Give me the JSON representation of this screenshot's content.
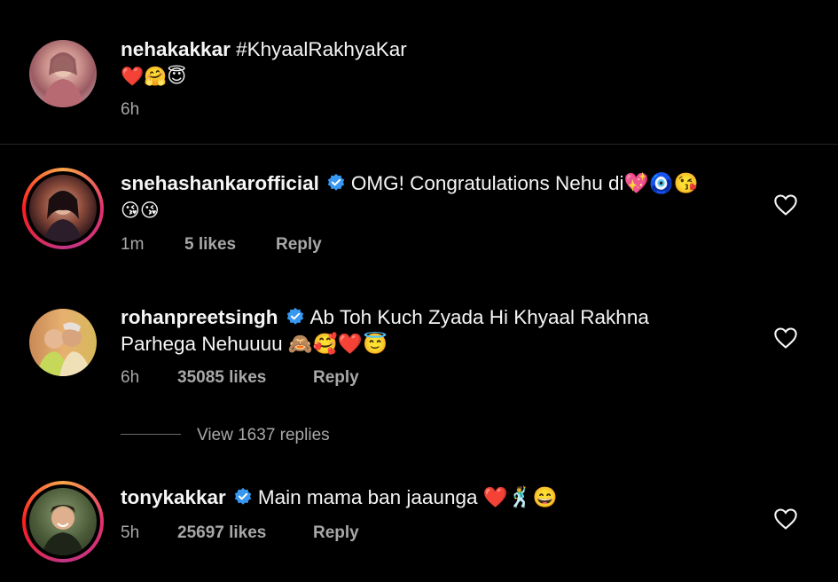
{
  "post": {
    "username": "nehakakkar",
    "caption": "#KhyaalRakhyaKar",
    "emojis": "❤️🤗😇",
    "time": "6h"
  },
  "comments": [
    {
      "username": "snehashankarofficial",
      "verified": true,
      "text_line1": "OMG! Congratulations Nehu di💖🧿😘",
      "text_line2": "😘😘",
      "time": "1m",
      "likes": "5 likes",
      "reply": "Reply",
      "ring": true
    },
    {
      "username": "rohanpreetsingh",
      "verified": true,
      "text_line1": "Ab Toh Kuch Zyada Hi Khyaal Rakhna",
      "text_line2": "Parhega Nehuuuu 🙈🥰❤️😇",
      "time": "6h",
      "likes": "35085 likes",
      "reply": "Reply",
      "ring": false
    },
    {
      "username": "tonykakkar",
      "verified": true,
      "text_line1": "Main mama ban jaaunga ❤️🕺😄",
      "time": "5h",
      "likes": "25697 likes",
      "reply": "Reply",
      "ring": true
    }
  ],
  "view_replies": "View 1637 replies",
  "colors": {
    "background": "#000000",
    "text": "#f5f5f5",
    "muted": "#a8a8a8",
    "verified": "#3897f0"
  }
}
